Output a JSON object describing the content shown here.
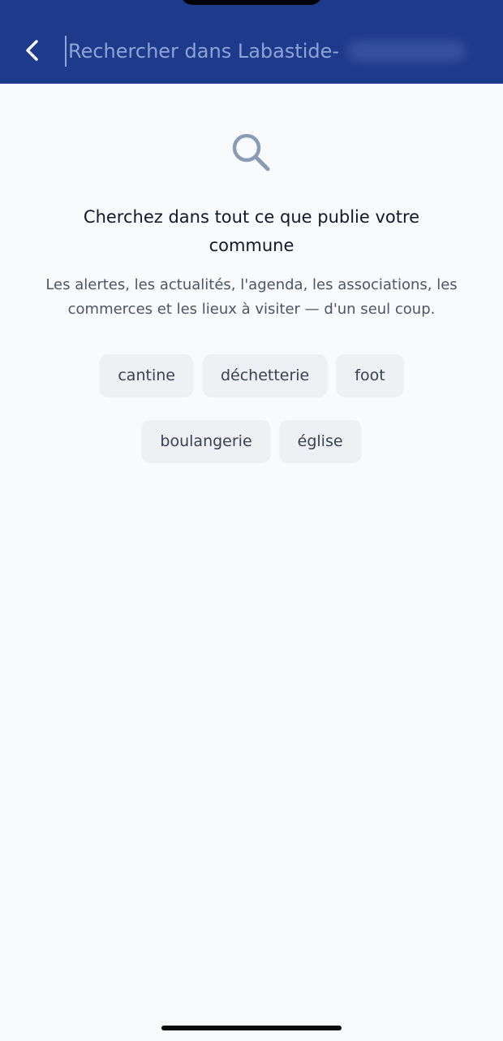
{
  "header": {
    "background_color": "#1e3a8a",
    "back_icon": "chevron-left-icon",
    "search_placeholder": "Rechercher dans Labastide-"
  },
  "empty_state": {
    "icon": "search-icon",
    "title": "Cherchez dans tout ce que publie votre commune",
    "description": "Les alertes, les actualités, l'agenda, les associations, les commerces et les lieux à visiter — d'un seul coup."
  },
  "suggestions": [
    {
      "label": "cantine"
    },
    {
      "label": "déchetterie"
    },
    {
      "label": "foot"
    },
    {
      "label": "boulangerie"
    },
    {
      "label": "église"
    }
  ]
}
